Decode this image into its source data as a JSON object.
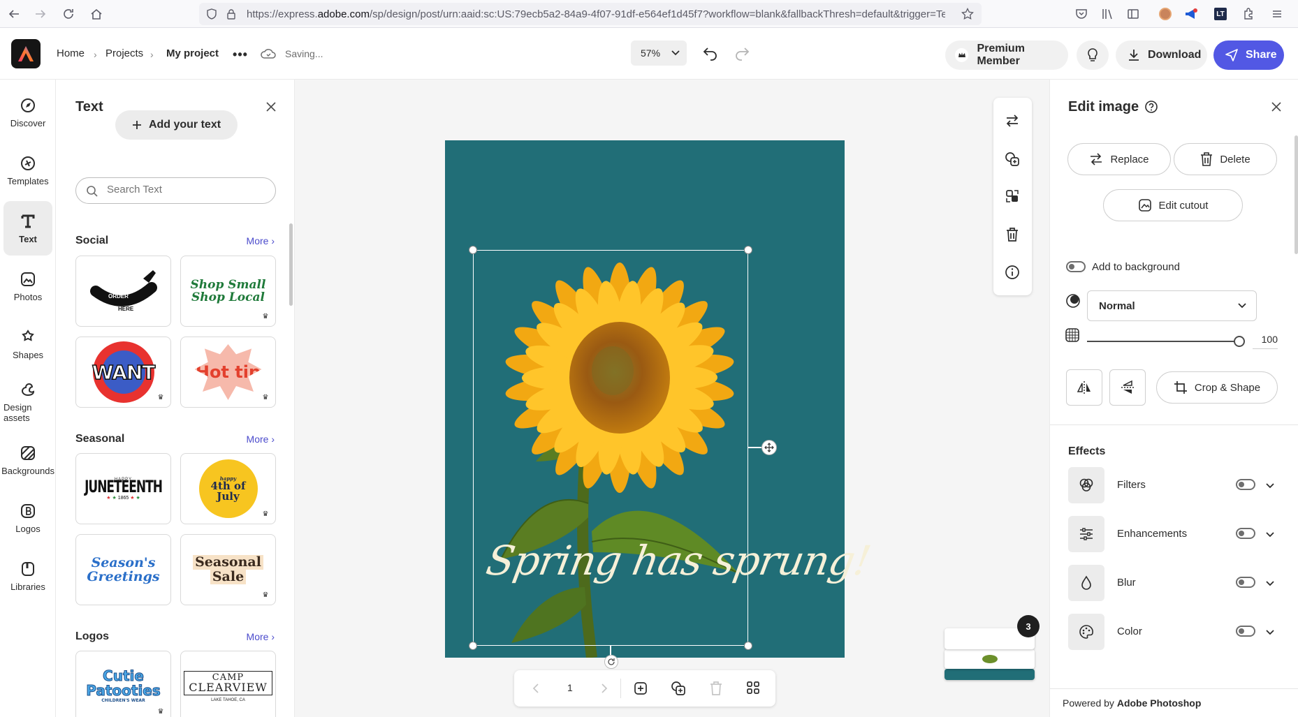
{
  "browser": {
    "url_prefix": "https://express.",
    "url_domain": "adobe.com",
    "url_rest": "/sp/design/post/urn:aaid:sc:US:79ecb5a2-84a9-4f07-91df-e564ef1d45f7?workflow=blank&fallbackThresh=default&trigger=Ten"
  },
  "header": {
    "home": "Home",
    "projects": "Projects",
    "current": "My project",
    "status": "Saving...",
    "zoom": "57%",
    "premium": "Premium Member",
    "download": "Download",
    "share": "Share"
  },
  "rail": [
    {
      "label": "Discover",
      "icon": "discover-icon"
    },
    {
      "label": "Templates",
      "icon": "templates-icon"
    },
    {
      "label": "Text",
      "icon": "text-icon"
    },
    {
      "label": "Photos",
      "icon": "photos-icon"
    },
    {
      "label": "Shapes",
      "icon": "shapes-icon"
    },
    {
      "label": "Design assets",
      "icon": "design-assets-icon"
    },
    {
      "label": "Backgrounds",
      "icon": "backgrounds-icon"
    },
    {
      "label": "Logos",
      "icon": "logos-icon"
    },
    {
      "label": "Libraries",
      "icon": "libraries-icon"
    }
  ],
  "textpanel": {
    "title": "Text",
    "add_button": "Add your text",
    "search_placeholder": "Search Text",
    "more": "More",
    "sections": [
      {
        "title": "Social",
        "cards": [
          {
            "line1": "ORDER",
            "line2": "HERE"
          },
          {
            "line1": "Shop Small",
            "line2": "Shop Local"
          },
          {
            "line1": "WANT"
          },
          {
            "line1": "Hot tip"
          }
        ]
      },
      {
        "title": "Seasonal",
        "cards": [
          {
            "line0": "HAPPY",
            "line1": "JUNETEENTH",
            "line2": "1865"
          },
          {
            "line0": "happy",
            "line1": "4th of",
            "line2": "July"
          },
          {
            "line1": "Season's",
            "line2": "Greetings"
          },
          {
            "line1": "Seasonal",
            "line2": "Sale"
          }
        ]
      },
      {
        "title": "Logos",
        "cards": [
          {
            "line1": "Cutie",
            "line2": "Patooties",
            "line3": "CHILDREN'S WEAR"
          },
          {
            "line1": "CAMP",
            "line2": "CLEARVIEW",
            "line3": "LAKE TAHOE, CA"
          }
        ]
      }
    ]
  },
  "canvas": {
    "headline": "Spring has sprung!",
    "page_number": "1",
    "pages_badge": "3"
  },
  "editpanel": {
    "title": "Edit image",
    "replace": "Replace",
    "delete": "Delete",
    "edit_cutout": "Edit cutout",
    "add_to_background": "Add to background",
    "blend_mode": "Normal",
    "opacity": "100",
    "opacity_level": 1.0,
    "crop": "Crop & Shape",
    "effects_title": "Effects",
    "effects": [
      {
        "label": "Filters",
        "icon": "filters-icon"
      },
      {
        "label": "Enhancements",
        "icon": "enhancements-icon"
      },
      {
        "label": "Blur",
        "icon": "blur-icon"
      },
      {
        "label": "Color",
        "icon": "color-icon"
      }
    ],
    "powered_prefix": "Powered by ",
    "powered_brand": "Adobe Photoshop"
  }
}
